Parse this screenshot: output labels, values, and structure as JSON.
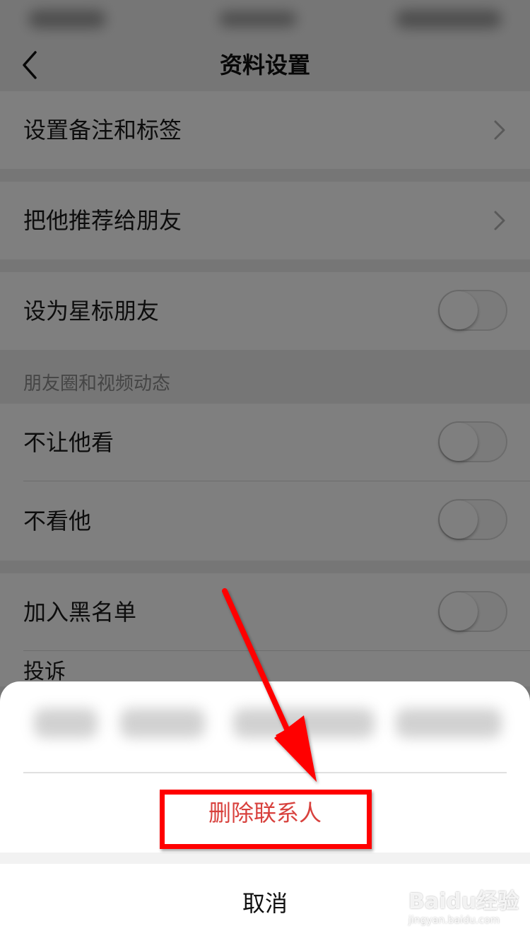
{
  "nav": {
    "title": "资料设置"
  },
  "rows": {
    "remark": "设置备注和标签",
    "recommend": "把他推荐给朋友",
    "star": "设为星标朋友",
    "hide_from": "不让他看",
    "not_see": "不看他",
    "blacklist": "加入黑名单",
    "report_partial": "投诉"
  },
  "groups": {
    "moments": "朋友圈和视频动态"
  },
  "toggles": {
    "star": false,
    "hide_from": false,
    "not_see": false,
    "blacklist": false
  },
  "sheet": {
    "delete_label": "删除联系人",
    "cancel_label": "取消"
  },
  "watermark": {
    "main": "Baidu经验",
    "sub": "jingyan.baidu.com"
  },
  "colors": {
    "danger": "#d8413d",
    "annotation": "#ff0000",
    "background": "#ededed"
  },
  "icons": {
    "back": "chevron-left-icon",
    "row_arrow": "chevron-right-icon"
  }
}
